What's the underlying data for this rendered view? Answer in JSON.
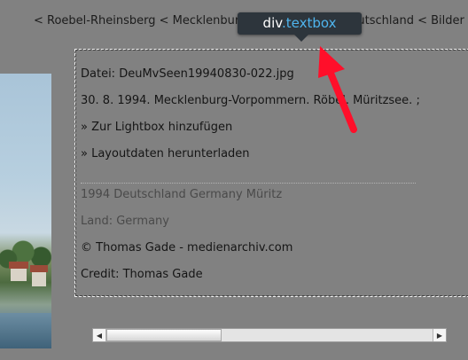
{
  "breadcrumb": {
    "text": "< Roebel-Rheinsberg < Mecklenburg-Vorpommern < Deutschland < Bilder"
  },
  "textbox": {
    "filename": "Datei: DeuMvSeen19940830-022.jpg",
    "caption": "30. 8. 1994. Mecklenburg-Vorpommern. Röbel. Müritzsee. ;",
    "add_lightbox": "» Zur Lightbox hinzufügen",
    "download_layout": "» Layoutdaten herunterladen",
    "keywords": "1994 Deutschland Germany Müritz",
    "country": "Land: Germany",
    "copyright": "© Thomas Gade - medienarchiv.com",
    "credit": "Credit: Thomas Gade"
  },
  "tooltip": {
    "tag": "div",
    "class_name": ".textbox"
  },
  "colors": {
    "background": "#818181",
    "tooltip_bg": "#2d353c",
    "tooltip_class": "#4fb5ee",
    "arrow": "#ff0f2a"
  },
  "icons": {
    "scroll_left": "◀",
    "scroll_right": "▶"
  }
}
